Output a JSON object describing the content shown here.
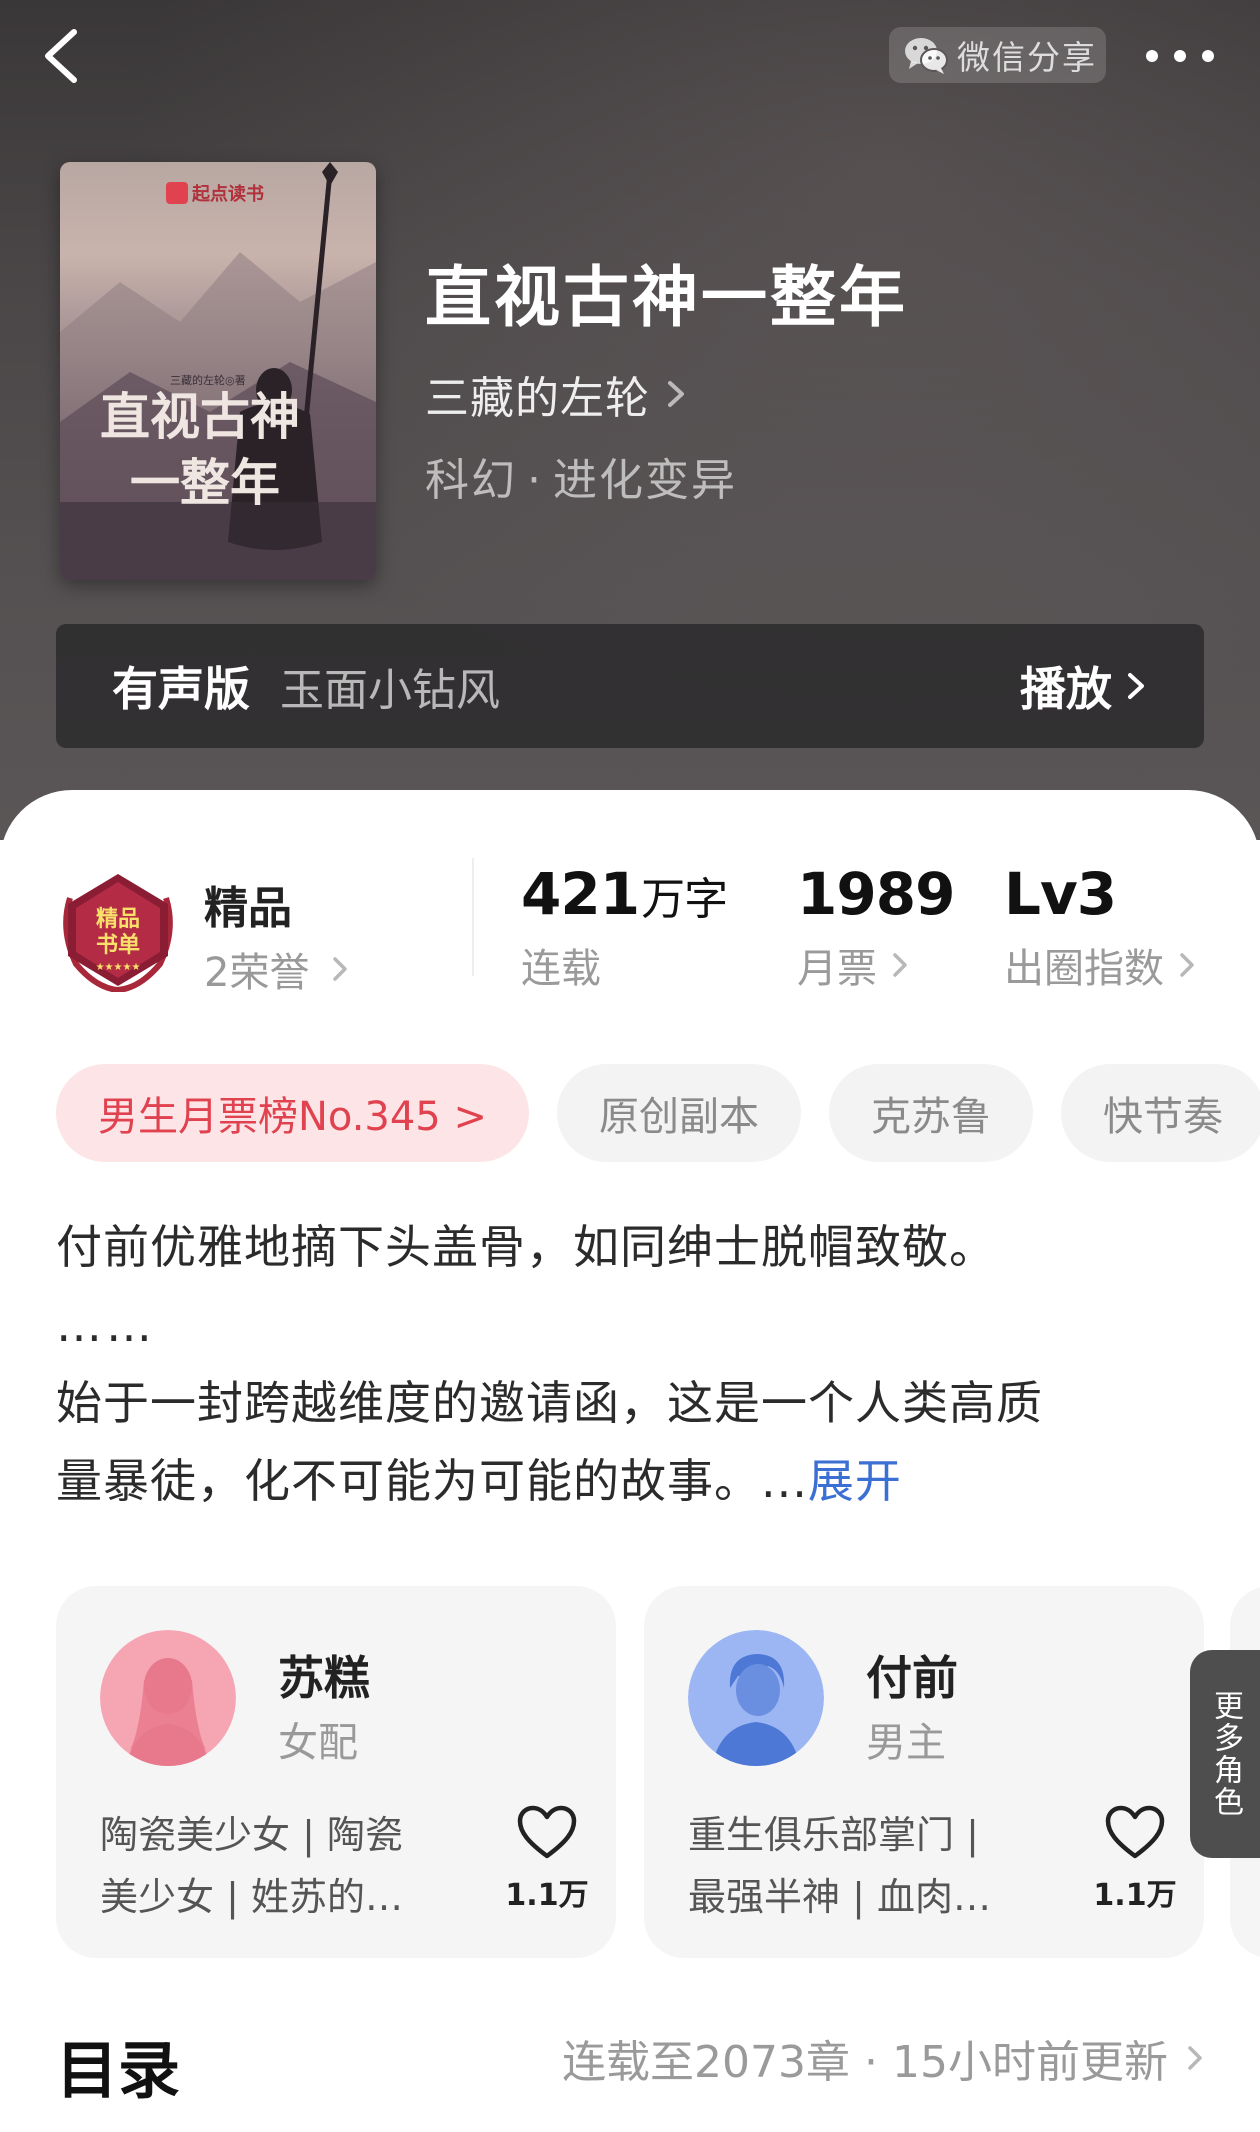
{
  "header": {
    "share_label": "微信分享",
    "back_icon": "chevron-left-icon",
    "more_icon": "more-dots-icon"
  },
  "book": {
    "title": "直视古神一整年",
    "author": "三藏的左轮",
    "category": "科幻",
    "subcategory": "进化变异",
    "cover": {
      "brand": "起点读书",
      "title_line1": "直视古神",
      "title_line2": "一整年",
      "author_credit": "三藏的左轮◎著"
    }
  },
  "audio": {
    "label": "有声版",
    "narrator": "玉面小钻风",
    "action": "播放"
  },
  "honor": {
    "badge_text": "精品书单",
    "title": "精品",
    "count": "2荣誉"
  },
  "stats": {
    "words_value": "421",
    "words_unit": "万字",
    "words_label": "连载",
    "tickets_value": "1989",
    "tickets_label": "月票",
    "level_value": "Lv3",
    "level_label": "出圈指数"
  },
  "tags": {
    "rank": "男生月票榜No.345 >",
    "t1": "原创副本",
    "t2": "克苏鲁",
    "t3": "快节奏"
  },
  "synopsis": {
    "line1": "付前优雅地摘下头盖骨，如同绅士脱帽致敬。",
    "line2": "……",
    "line3": "始于一封跨越维度的邀请函，这是一个人类高质",
    "line4": "量暴徒，化不可能为可能的故事。...",
    "expand": "展开"
  },
  "characters": [
    {
      "name": "苏糕",
      "role": "女配",
      "desc1": "陶瓷美少女 | 陶瓷",
      "desc2": "美少女 | 姓苏的…",
      "likes": "1.1万"
    },
    {
      "name": "付前",
      "role": "男主",
      "desc1": "重生俱乐部掌门 |",
      "desc2": "最强半神 | 血肉…",
      "likes": "1.1万"
    }
  ],
  "more_roles": "更多角色",
  "toc": {
    "title": "目录",
    "status": "连载至2073章 · 15小时前更新"
  },
  "colors": {
    "accent_red": "#e0424f",
    "link_blue": "#3b6fd3",
    "header_dark": "#4b4748"
  }
}
